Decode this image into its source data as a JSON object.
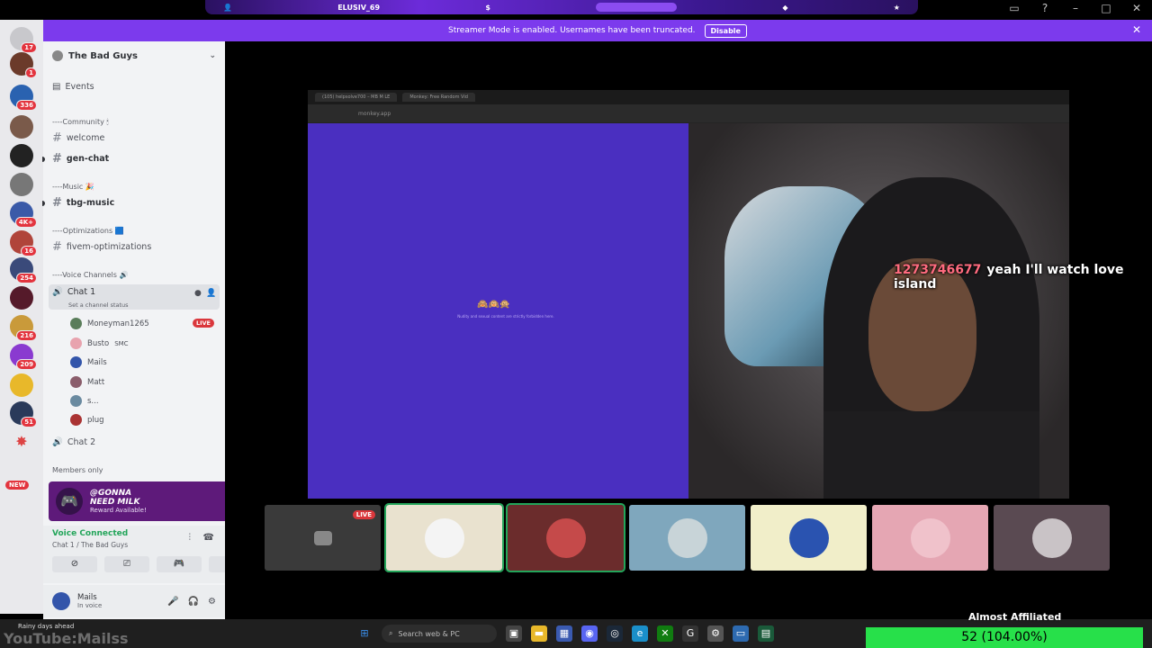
{
  "overlay": {
    "username": "ELUSIV_69"
  },
  "banner": {
    "text": "Streamer Mode is enabled. Usernames have been truncated.",
    "button": "Disable"
  },
  "rail": {
    "badges": [
      "17",
      "1",
      "336",
      "",
      "",
      "",
      "4K+",
      "16",
      "254",
      "",
      "216",
      "209",
      "",
      "51",
      ""
    ],
    "new_label": "NEW"
  },
  "guild": {
    "name": "The Bad Guys"
  },
  "channels": {
    "events": "Events",
    "cat_community": "----Community 🕯",
    "welcome": "welcome",
    "gen_chat": "gen-chat",
    "cat_music": "----Music 🎉",
    "tbg_music": "tbg-music",
    "cat_opt": "----Optimizations 🟦",
    "fivem": "fivem-optimizations",
    "cat_voice": "----Voice Channels 🔊",
    "chat1": "Chat 1",
    "chat1_status": "Set a channel status",
    "chat2": "Chat 2",
    "members_only": "Members only"
  },
  "voice_users": [
    {
      "name": "Moneyman1265",
      "color": "#5a7d5a",
      "live": "LIVE"
    },
    {
      "name": "Busto",
      "color": "#e8a3ae",
      "tag": "SMC"
    },
    {
      "name": "Mails",
      "color": "#3355aa"
    },
    {
      "name": "Matt",
      "color": "#8a5d6b"
    },
    {
      "name": "s...",
      "color": "#6a8aa0"
    },
    {
      "name": "plug",
      "color": "#a33"
    }
  ],
  "reward": {
    "title1": "@GONNA",
    "title2": "NEED MILK",
    "sub": "Reward Available!"
  },
  "voice_panel": {
    "status": "Voice Connected",
    "channel": "Chat 1 / The Bad Guys"
  },
  "user_panel": {
    "name": "Mails",
    "status": "In voice"
  },
  "browser": {
    "tab1": "(105) helpsolve700 – MB M LE",
    "tab2": "Monkey: Free Random Vid",
    "url": "monkey.app",
    "emoji": "🙈🙉🙊",
    "note": "Nudity and sexual content are strictly forbidden here."
  },
  "chat_message": {
    "user": "1273746677",
    "text": "yeah I'll watch love island"
  },
  "tiles": [
    {
      "bg": "#3a3a3a",
      "inner": "#888",
      "live": "LIVE"
    },
    {
      "bg": "#e9e2cf",
      "inner": "#f4f4f4"
    },
    {
      "bg": "#6b2c2c",
      "inner": "#c54a4a"
    },
    {
      "bg": "#7fa7bd",
      "inner": "#c8d4d8"
    },
    {
      "bg": "#f1eec9",
      "inner": "#2a53b0"
    },
    {
      "bg": "#e5a6b3",
      "inner": "#f0c2cb"
    },
    {
      "bg": "#5a4a52",
      "inner": "#c9c3c6"
    }
  ],
  "taskbar": {
    "weather": "Rainy days ahead",
    "search": "Search web & PC",
    "watermark": "YouTube:Mailss"
  },
  "goal": {
    "label": "Almost Affiliated",
    "value": "52 (104.00%)"
  }
}
